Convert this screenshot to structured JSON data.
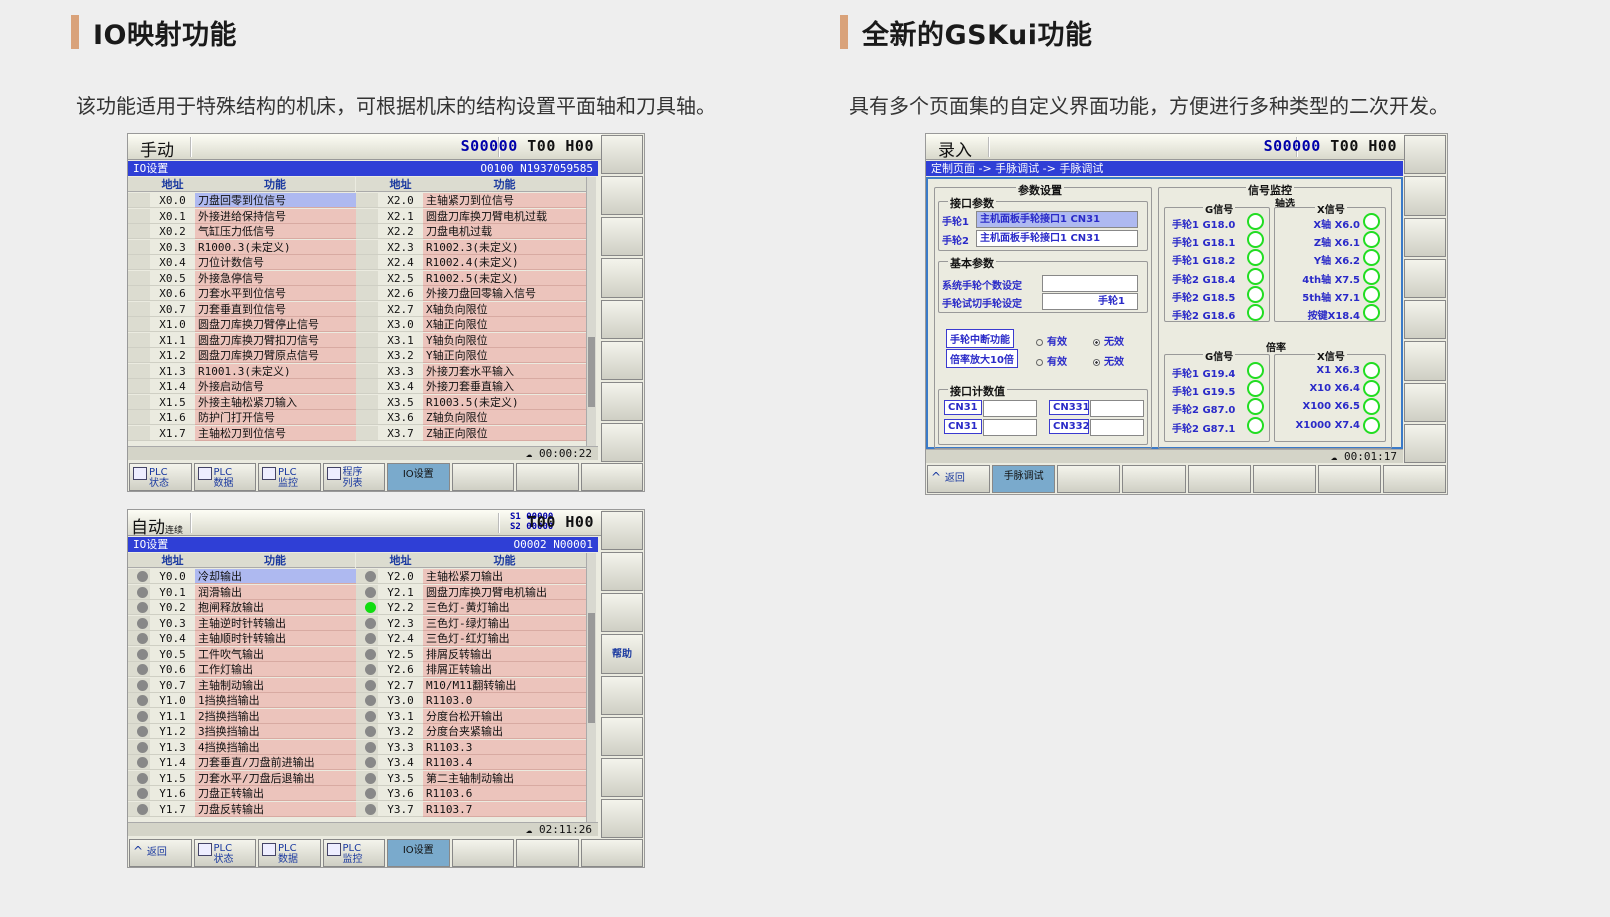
{
  "left": {
    "title": "IO映射功能",
    "desc": "该功能适用于特殊结构的机床，可根据机床的结构设置平面轴和刀具轴。",
    "screen1": {
      "mode": "手动",
      "sth": {
        "s": "S00000",
        "t": "T00",
        "h": "H00"
      },
      "window_title": "IO设置",
      "prog": "O0100 N1937059585",
      "headers": {
        "addr": "地址",
        "func": "功能"
      },
      "left_rows": [
        {
          "addr": "X0.0",
          "func": "刀盘回零到位信号"
        },
        {
          "addr": "X0.1",
          "func": "外接进给保持信号"
        },
        {
          "addr": "X0.2",
          "func": "气缸压力低信号"
        },
        {
          "addr": "X0.3",
          "func": "R1000.3(未定义)"
        },
        {
          "addr": "X0.4",
          "func": "刀位计数信号"
        },
        {
          "addr": "X0.5",
          "func": "外接急停信号"
        },
        {
          "addr": "X0.6",
          "func": "刀套水平到位信号"
        },
        {
          "addr": "X0.7",
          "func": "刀套垂直到位信号"
        },
        {
          "addr": "X1.0",
          "func": "圆盘刀库换刀臂停止信号"
        },
        {
          "addr": "X1.1",
          "func": "圆盘刀库换刀臂扣刀信号"
        },
        {
          "addr": "X1.2",
          "func": "圆盘刀库换刀臂原点信号"
        },
        {
          "addr": "X1.3",
          "func": "R1001.3(未定义)"
        },
        {
          "addr": "X1.4",
          "func": "外接启动信号"
        },
        {
          "addr": "X1.5",
          "func": "外接主轴松紧刀输入"
        },
        {
          "addr": "X1.6",
          "func": "防护门打开信号"
        },
        {
          "addr": "X1.7",
          "func": "主轴松刀到位信号"
        }
      ],
      "right_rows": [
        {
          "addr": "X2.0",
          "func": "主轴紧刀到位信号"
        },
        {
          "addr": "X2.1",
          "func": "圆盘刀库换刀臂电机过载"
        },
        {
          "addr": "X2.2",
          "func": "刀盘电机过载"
        },
        {
          "addr": "X2.3",
          "func": "R1002.3(未定义)"
        },
        {
          "addr": "X2.4",
          "func": "R1002.4(未定义)"
        },
        {
          "addr": "X2.5",
          "func": "R1002.5(未定义)"
        },
        {
          "addr": "X2.6",
          "func": "外接刀盘回零输入信号"
        },
        {
          "addr": "X2.7",
          "func": "X轴负向限位"
        },
        {
          "addr": "X3.0",
          "func": "X轴正向限位"
        },
        {
          "addr": "X3.1",
          "func": "Y轴负向限位"
        },
        {
          "addr": "X3.2",
          "func": "Y轴正向限位"
        },
        {
          "addr": "X3.3",
          "func": "外接刀套水平输入"
        },
        {
          "addr": "X3.4",
          "func": "外接刀套垂直输入"
        },
        {
          "addr": "X3.5",
          "func": "R1003.5(未定义)"
        },
        {
          "addr": "X3.6",
          "func": "Z轴负向限位"
        },
        {
          "addr": "X3.7",
          "func": "Z轴正向限位"
        }
      ],
      "time": "00:00:22",
      "bottom": [
        {
          "l1": "PLC",
          "l2": "状态"
        },
        {
          "l1": "PLC",
          "l2": "数据"
        },
        {
          "l1": "PLC",
          "l2": "监控"
        },
        {
          "l1": "程序",
          "l2": "列表"
        },
        {
          "l1": "IO设置",
          "l2": ""
        }
      ]
    },
    "screen2": {
      "mode": "自动",
      "mode_sub": "连续",
      "s1": "S1 00000",
      "s2": "S2 00000",
      "t": "T00",
      "h": "H00",
      "window_title": "IO设置",
      "prog": "O0002 N00001",
      "headers": {
        "addr": "地址",
        "func": "功能"
      },
      "left_rows": [
        {
          "addr": "Y0.0",
          "func": "冷却输出",
          "on": false
        },
        {
          "addr": "Y0.1",
          "func": "润滑输出",
          "on": false
        },
        {
          "addr": "Y0.2",
          "func": "抱闸释放输出",
          "on": false
        },
        {
          "addr": "Y0.3",
          "func": "主轴逆时针转输出",
          "on": false
        },
        {
          "addr": "Y0.4",
          "func": "主轴顺时针转输出",
          "on": false
        },
        {
          "addr": "Y0.5",
          "func": "工件吹气输出",
          "on": false
        },
        {
          "addr": "Y0.6",
          "func": "工作灯输出",
          "on": false
        },
        {
          "addr": "Y0.7",
          "func": "主轴制动输出",
          "on": false
        },
        {
          "addr": "Y1.0",
          "func": "1挡换挡输出",
          "on": false
        },
        {
          "addr": "Y1.1",
          "func": "2挡换挡输出",
          "on": false
        },
        {
          "addr": "Y1.2",
          "func": "3挡换挡输出",
          "on": false
        },
        {
          "addr": "Y1.3",
          "func": "4挡换挡输出",
          "on": false
        },
        {
          "addr": "Y1.4",
          "func": "刀套垂直/刀盘前进输出",
          "on": false
        },
        {
          "addr": "Y1.5",
          "func": "刀套水平/刀盘后退输出",
          "on": false
        },
        {
          "addr": "Y1.6",
          "func": "刀盘正转输出",
          "on": false
        },
        {
          "addr": "Y1.7",
          "func": "刀盘反转输出",
          "on": false
        }
      ],
      "right_rows": [
        {
          "addr": "Y2.0",
          "func": "主轴松紧刀输出",
          "on": false
        },
        {
          "addr": "Y2.1",
          "func": "圆盘刀库换刀臂电机输出",
          "on": false
        },
        {
          "addr": "Y2.2",
          "func": "三色灯-黄灯输出",
          "on": true
        },
        {
          "addr": "Y2.3",
          "func": "三色灯-绿灯输出",
          "on": false
        },
        {
          "addr": "Y2.4",
          "func": "三色灯-红灯输出",
          "on": false
        },
        {
          "addr": "Y2.5",
          "func": "排屑反转输出",
          "on": false
        },
        {
          "addr": "Y2.6",
          "func": "排屑正转输出",
          "on": false
        },
        {
          "addr": "Y2.7",
          "func": "M10/M11翻转输出",
          "on": false
        },
        {
          "addr": "Y3.0",
          "func": "R1103.0",
          "on": false
        },
        {
          "addr": "Y3.1",
          "func": "分度台松开输出",
          "on": false
        },
        {
          "addr": "Y3.2",
          "func": "分度台夹紧输出",
          "on": false
        },
        {
          "addr": "Y3.3",
          "func": "R1103.3",
          "on": false
        },
        {
          "addr": "Y3.4",
          "func": "R1103.4",
          "on": false
        },
        {
          "addr": "Y3.5",
          "func": "第二主轴制动输出",
          "on": false
        },
        {
          "addr": "Y3.6",
          "func": "R1103.6",
          "on": false
        },
        {
          "addr": "Y3.7",
          "func": "R1103.7",
          "on": false
        }
      ],
      "time": "02:11:26",
      "side_help": "帮助",
      "bottom": [
        {
          "l1": "返回",
          "l2": ""
        },
        {
          "l1": "PLC",
          "l2": "状态"
        },
        {
          "l1": "PLC",
          "l2": "数据"
        },
        {
          "l1": "PLC",
          "l2": "监控"
        },
        {
          "l1": "IO设置",
          "l2": ""
        }
      ]
    }
  },
  "right": {
    "title": "全新的GSKui功能",
    "desc": "具有多个页面集的自定义界面功能，方便进行多种类型的二次开发。",
    "screen": {
      "mode": "录入",
      "sth": {
        "s": "S00000",
        "t": "T00",
        "h": "H00"
      },
      "breadcrumb": "定制页面 -> 手脉调试 -> 手脉调试",
      "param_title": "参数设置",
      "iface_title": "接口参数",
      "wheel1_label": "手轮1",
      "wheel1_value": "主机面板手轮接口1 CN31",
      "wheel2_label": "手轮2",
      "wheel2_value": "主机面板手轮接口1 CN31",
      "basic_title": "基本参数",
      "sys_count_label": "系统手轮个数设定",
      "sys_count_value": "",
      "trial_label": "手轮试切手轮设定",
      "trial_value": "手轮1",
      "interrupt_btn": "手轮中断功能",
      "mag_btn": "倍率放大10倍",
      "valid": "有效",
      "invalid": "无效",
      "count_title": "接口计数值",
      "counters": [
        "CN31",
        "CN31",
        "CN331",
        "CN332"
      ],
      "monitor_title": "信号监控",
      "axis_title": "轴选",
      "g_title": "G信号",
      "x_title": "X信号",
      "rate_title": "倍率",
      "axis_g": [
        "手轮1 G18.0",
        "手轮1 G18.1",
        "手轮1 G18.2",
        "手轮2 G18.4",
        "手轮2 G18.5",
        "手轮2 G18.6"
      ],
      "axis_x": [
        "X轴 X6.0",
        "Z轴 X6.1",
        "Y轴 X6.2",
        "4th轴 X7.5",
        "5th轴 X7.1",
        "按键X18.4"
      ],
      "rate_g": [
        "手轮1 G19.4",
        "手轮1 G19.5",
        "手轮2 G87.0",
        "手轮2 G87.1"
      ],
      "rate_x": [
        "X1 X6.3",
        "X10 X6.4",
        "X100 X6.5",
        "X1000 X7.4"
      ],
      "time": "00:01:17",
      "bottom": [
        "返回",
        "手脉调试"
      ]
    }
  }
}
